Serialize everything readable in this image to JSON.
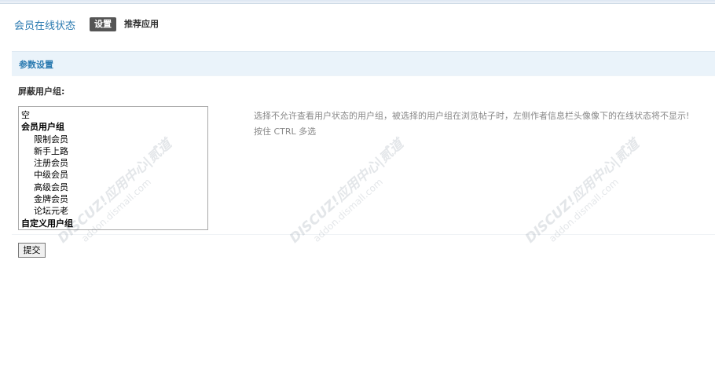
{
  "header": {
    "plugin_title": "会员在线状态",
    "tabs": [
      {
        "label": "设置",
        "active": true
      },
      {
        "label": "推荐应用",
        "active": false
      }
    ]
  },
  "section": {
    "title": "参数设置"
  },
  "form": {
    "field_label": "屏蔽用户组:",
    "options": [
      {
        "label": "空",
        "kind": "item"
      },
      {
        "label": "会员用户组",
        "kind": "group"
      },
      {
        "label": "限制会员",
        "kind": "child"
      },
      {
        "label": "新手上路",
        "kind": "child"
      },
      {
        "label": "注册会员",
        "kind": "child"
      },
      {
        "label": "中级会员",
        "kind": "child"
      },
      {
        "label": "高级会员",
        "kind": "child"
      },
      {
        "label": "金牌会员",
        "kind": "child"
      },
      {
        "label": "论坛元老",
        "kind": "child"
      },
      {
        "label": "自定义用户组",
        "kind": "group"
      }
    ],
    "hint_line1": "选择不允许查看用户状态的用户组，被选择的用户组在浏览帖子时，左侧作者信息栏头像像下的在线状态将不显示!",
    "hint_line2": "按住 CTRL 多选",
    "submit_label": "提交"
  },
  "watermark": {
    "line1": "DISCUZ!应用中心|贰道",
    "line2": "addon.dismall.com"
  },
  "colors": {
    "accent": "#2a7ab0",
    "section_bg": "#eaf3fa",
    "active_tab_bg": "#555555"
  }
}
